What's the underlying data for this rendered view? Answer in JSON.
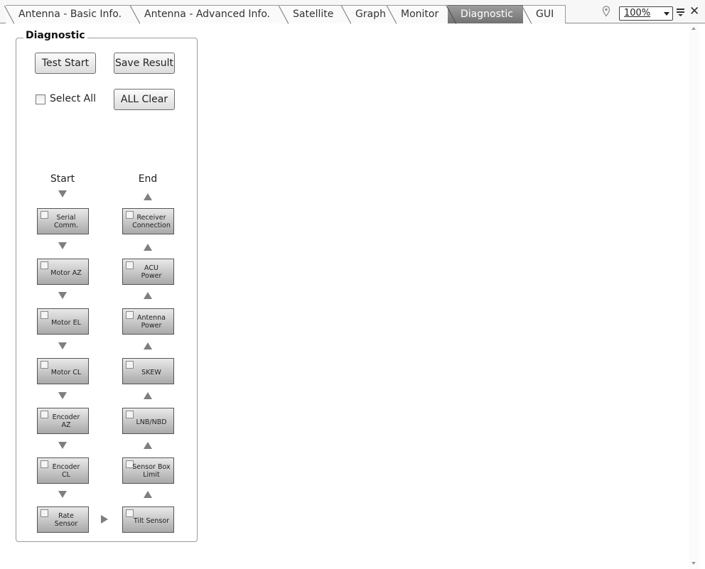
{
  "tabs": [
    {
      "label": "Antenna - Basic Info.",
      "active": false
    },
    {
      "label": "Antenna - Advanced Info.",
      "active": false
    },
    {
      "label": "Satellite",
      "active": false
    },
    {
      "label": "Graph",
      "active": false
    },
    {
      "label": "Monitor",
      "active": false
    },
    {
      "label": "Diagnostic",
      "active": true
    },
    {
      "label": "GUI",
      "active": false
    }
  ],
  "toolbar": {
    "zoom_value": "100%",
    "icons": [
      "pin-icon",
      "chevron-down-icon",
      "menu-icon",
      "close-icon"
    ],
    "close_glyph": "✕"
  },
  "diagnostic": {
    "title": "Diagnostic",
    "test_start_label": "Test Start",
    "save_result_label": "Save Result",
    "select_all_label": "Select All",
    "select_all_checked": false,
    "all_clear_label": "ALL Clear",
    "start_label": "Start",
    "end_label": "End",
    "start_steps": [
      {
        "label": "Serial\nComm.",
        "checked": false
      },
      {
        "label": "Motor AZ",
        "checked": false
      },
      {
        "label": "Motor EL",
        "checked": false
      },
      {
        "label": "Motor CL",
        "checked": false
      },
      {
        "label": "Encoder\nAZ",
        "checked": false
      },
      {
        "label": "Encoder\nCL",
        "checked": false
      },
      {
        "label": "Rate\nSensor",
        "checked": false
      }
    ],
    "end_steps": [
      {
        "label": "Receiver\nConnection",
        "checked": false
      },
      {
        "label": "ACU\nPower",
        "checked": false
      },
      {
        "label": "Antenna\nPower",
        "checked": false
      },
      {
        "label": "SKEW",
        "checked": false
      },
      {
        "label": "LNB/NBD",
        "checked": false
      },
      {
        "label": "Sensor Box\nLimit",
        "checked": false
      },
      {
        "label": "Tilt Sensor",
        "checked": false
      }
    ]
  },
  "colors": {
    "active_tab": "#868686",
    "step_button_top": "#e9e9e9",
    "step_button_bottom": "#a9a9a9",
    "flow_arrow": "#7f7f7f"
  }
}
